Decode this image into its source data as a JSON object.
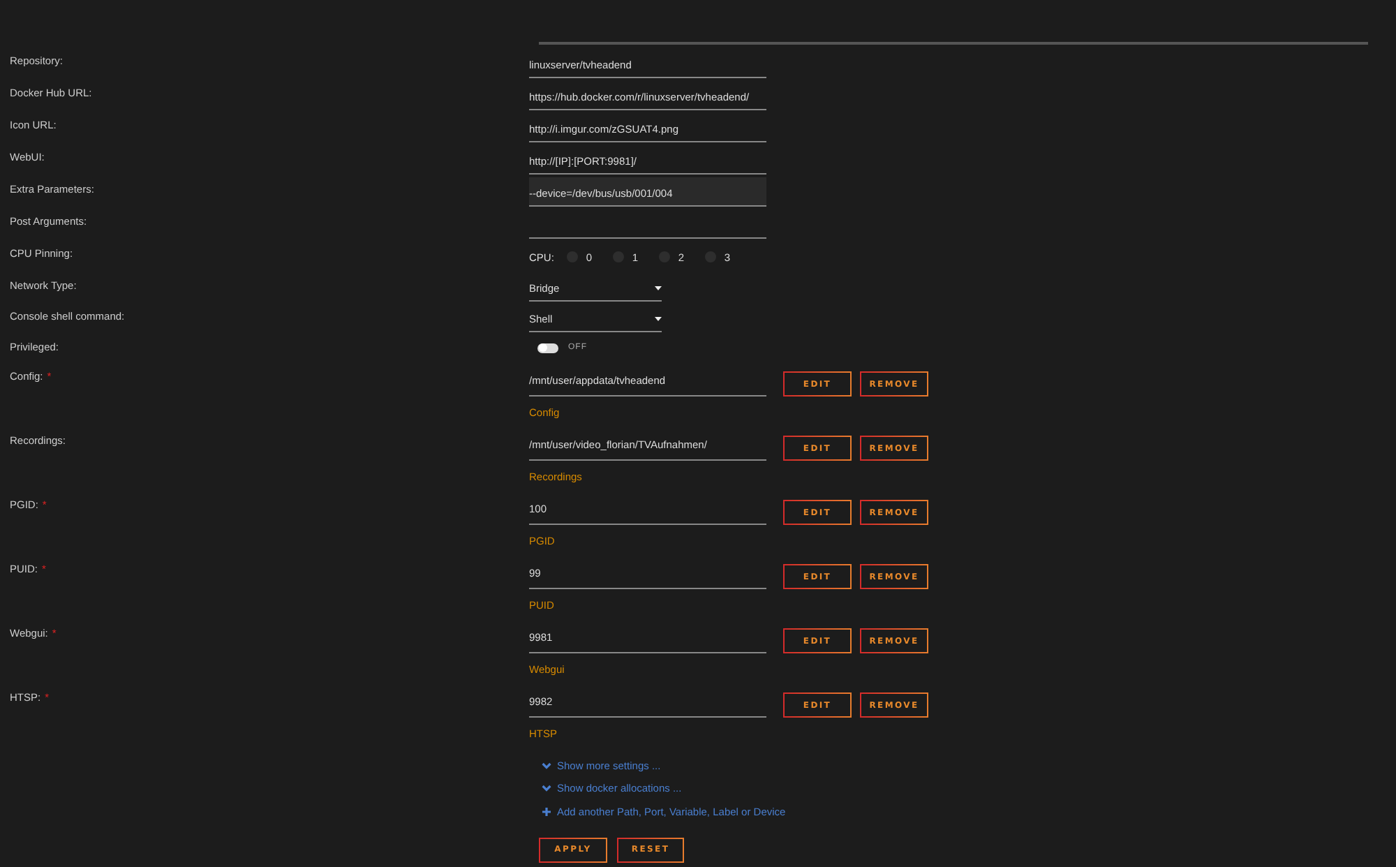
{
  "fields": [
    {
      "kind": "text",
      "label": "Repository:",
      "value": "linuxserver/tvheadend",
      "focused": false
    },
    {
      "kind": "text",
      "label": "Docker Hub URL:",
      "value": "https://hub.docker.com/r/linuxserver/tvheadend/",
      "focused": false
    },
    {
      "kind": "text",
      "label": "Icon URL:",
      "value": "http://i.imgur.com/zGSUAT4.png",
      "focused": false
    },
    {
      "kind": "text",
      "label": "WebUI:",
      "value": "http://[IP]:[PORT:9981]/",
      "focused": false
    },
    {
      "kind": "text",
      "label": "Extra Parameters:",
      "value": "--device=/dev/bus/usb/001/004",
      "focused": true
    },
    {
      "kind": "text",
      "label": "Post Arguments:",
      "focused": false
    },
    {
      "kind": "cpu",
      "label": "CPU Pinning:",
      "prefix": "CPU:",
      "cores": [
        {
          "label": "0",
          "selected": false
        },
        {
          "label": "1",
          "selected": false
        },
        {
          "label": "2",
          "selected": false
        },
        {
          "label": "3",
          "selected": false
        }
      ]
    },
    {
      "kind": "select",
      "label": "Network Type:",
      "value": "Bridge"
    },
    {
      "kind": "select",
      "label": "Console shell command:",
      "value": "Shell"
    },
    {
      "kind": "switch",
      "label": "Privileged:",
      "on": false,
      "state_text": "OFF"
    }
  ],
  "configs": [
    {
      "label": "Config:",
      "mark": "*",
      "value": "/mnt/user/appdata/tvheadend",
      "description": "Config",
      "edit": "EDIT",
      "remove": "REMOVE"
    },
    {
      "label": "Recordings:",
      "value": "/mnt/user/video_florian/TVAufnahmen/",
      "description": "Recordings",
      "edit": "EDIT",
      "remove": "REMOVE"
    },
    {
      "label": "PGID:",
      "mark": "*",
      "value": "100",
      "description": "PGID",
      "edit": "EDIT",
      "remove": "REMOVE"
    },
    {
      "label": "PUID:",
      "mark": "*",
      "value": "99",
      "description": "PUID",
      "edit": "EDIT",
      "remove": "REMOVE"
    },
    {
      "label": "Webgui:",
      "mark": "*",
      "value": "9981",
      "description": "Webgui",
      "edit": "EDIT",
      "remove": "REMOVE"
    },
    {
      "label": "HTSP:",
      "mark": "*",
      "value": "9982",
      "description": "HTSP",
      "edit": "EDIT",
      "remove": "REMOVE"
    }
  ],
  "links": [
    {
      "kind": "expand",
      "text": "Show more settings ..."
    },
    {
      "kind": "expand",
      "text": "Show docker allocations ..."
    },
    {
      "kind": "add",
      "text": "Add another Path, Port, Variable, Label or Device"
    }
  ],
  "actions": [
    "APPLY",
    "RESET"
  ]
}
